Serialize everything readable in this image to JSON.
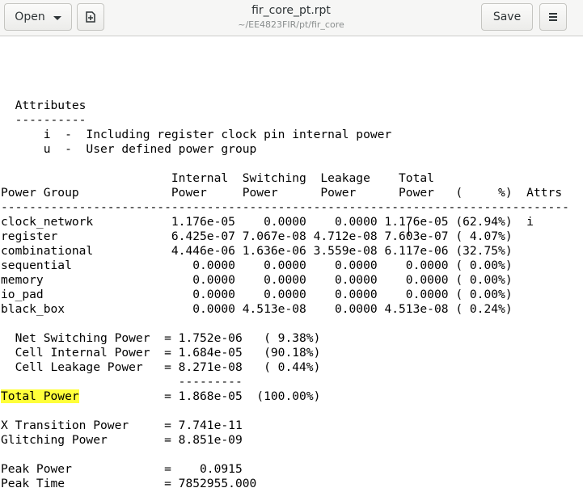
{
  "header": {
    "open_label": "Open",
    "title": "fir_core_pt.rpt",
    "subtitle": "~/EE4823FIR/pt/fir_core",
    "save_label": "Save",
    "icons": {
      "open_dropdown": "chevron-down-icon",
      "new_tab": "new-document-icon",
      "menu": "hamburger-menu-icon"
    }
  },
  "editor": {
    "highlight_color": "#ffff3a",
    "lines": [
      {
        "text": ""
      },
      {
        "text": "  Attributes"
      },
      {
        "text": "  ----------"
      },
      {
        "text": "      i  -  Including register clock pin internal power"
      },
      {
        "text": "      u  -  User defined power group"
      },
      {
        "text": ""
      },
      {
        "text": "                        Internal  Switching  Leakage    Total"
      },
      {
        "text": "Power Group             Power     Power      Power      Power   (     %)  Attrs"
      },
      {
        "text": "--------------------------------------------------------------------------------"
      },
      {
        "text": "clock_network           1.176e-05    0.0000    0.0000 1.176e-05 (62.94%)  i"
      },
      {
        "text": "register                6.425e-07 7.067e-08 4.712e-08 7.603e-07 ( 4.07%)"
      },
      {
        "text": "combinational           4.446e-06 1.636e-06 3.559e-08 6.117e-06 (32.75%)"
      },
      {
        "text": "sequential                 0.0000    0.0000    0.0000    0.0000 ( 0.00%)"
      },
      {
        "text": "memory                     0.0000    0.0000    0.0000    0.0000 ( 0.00%)"
      },
      {
        "text": "io_pad                     0.0000    0.0000    0.0000    0.0000 ( 0.00%)"
      },
      {
        "text": "black_box                  0.0000 4.513e-08    0.0000 4.513e-08 ( 0.24%)"
      },
      {
        "text": ""
      },
      {
        "text": "  Net Switching Power  = 1.752e-06   ( 9.38%)"
      },
      {
        "text": "  Cell Internal Power  = 1.684e-05   (90.18%)"
      },
      {
        "text": "  Cell Leakage Power   = 8.271e-08   ( 0.44%)"
      },
      {
        "text": "                         ---------"
      },
      {
        "highlight": "Total Power",
        "text": "            = 1.868e-05  (100.00%)"
      },
      {
        "text": ""
      },
      {
        "text": "X Transition Power     = 7.741e-11"
      },
      {
        "text": "Glitching Power        = 8.851e-09"
      },
      {
        "text": ""
      },
      {
        "text": "Peak Power             =    0.0915"
      },
      {
        "text": "Peak Time              = 7852955.000"
      }
    ]
  }
}
